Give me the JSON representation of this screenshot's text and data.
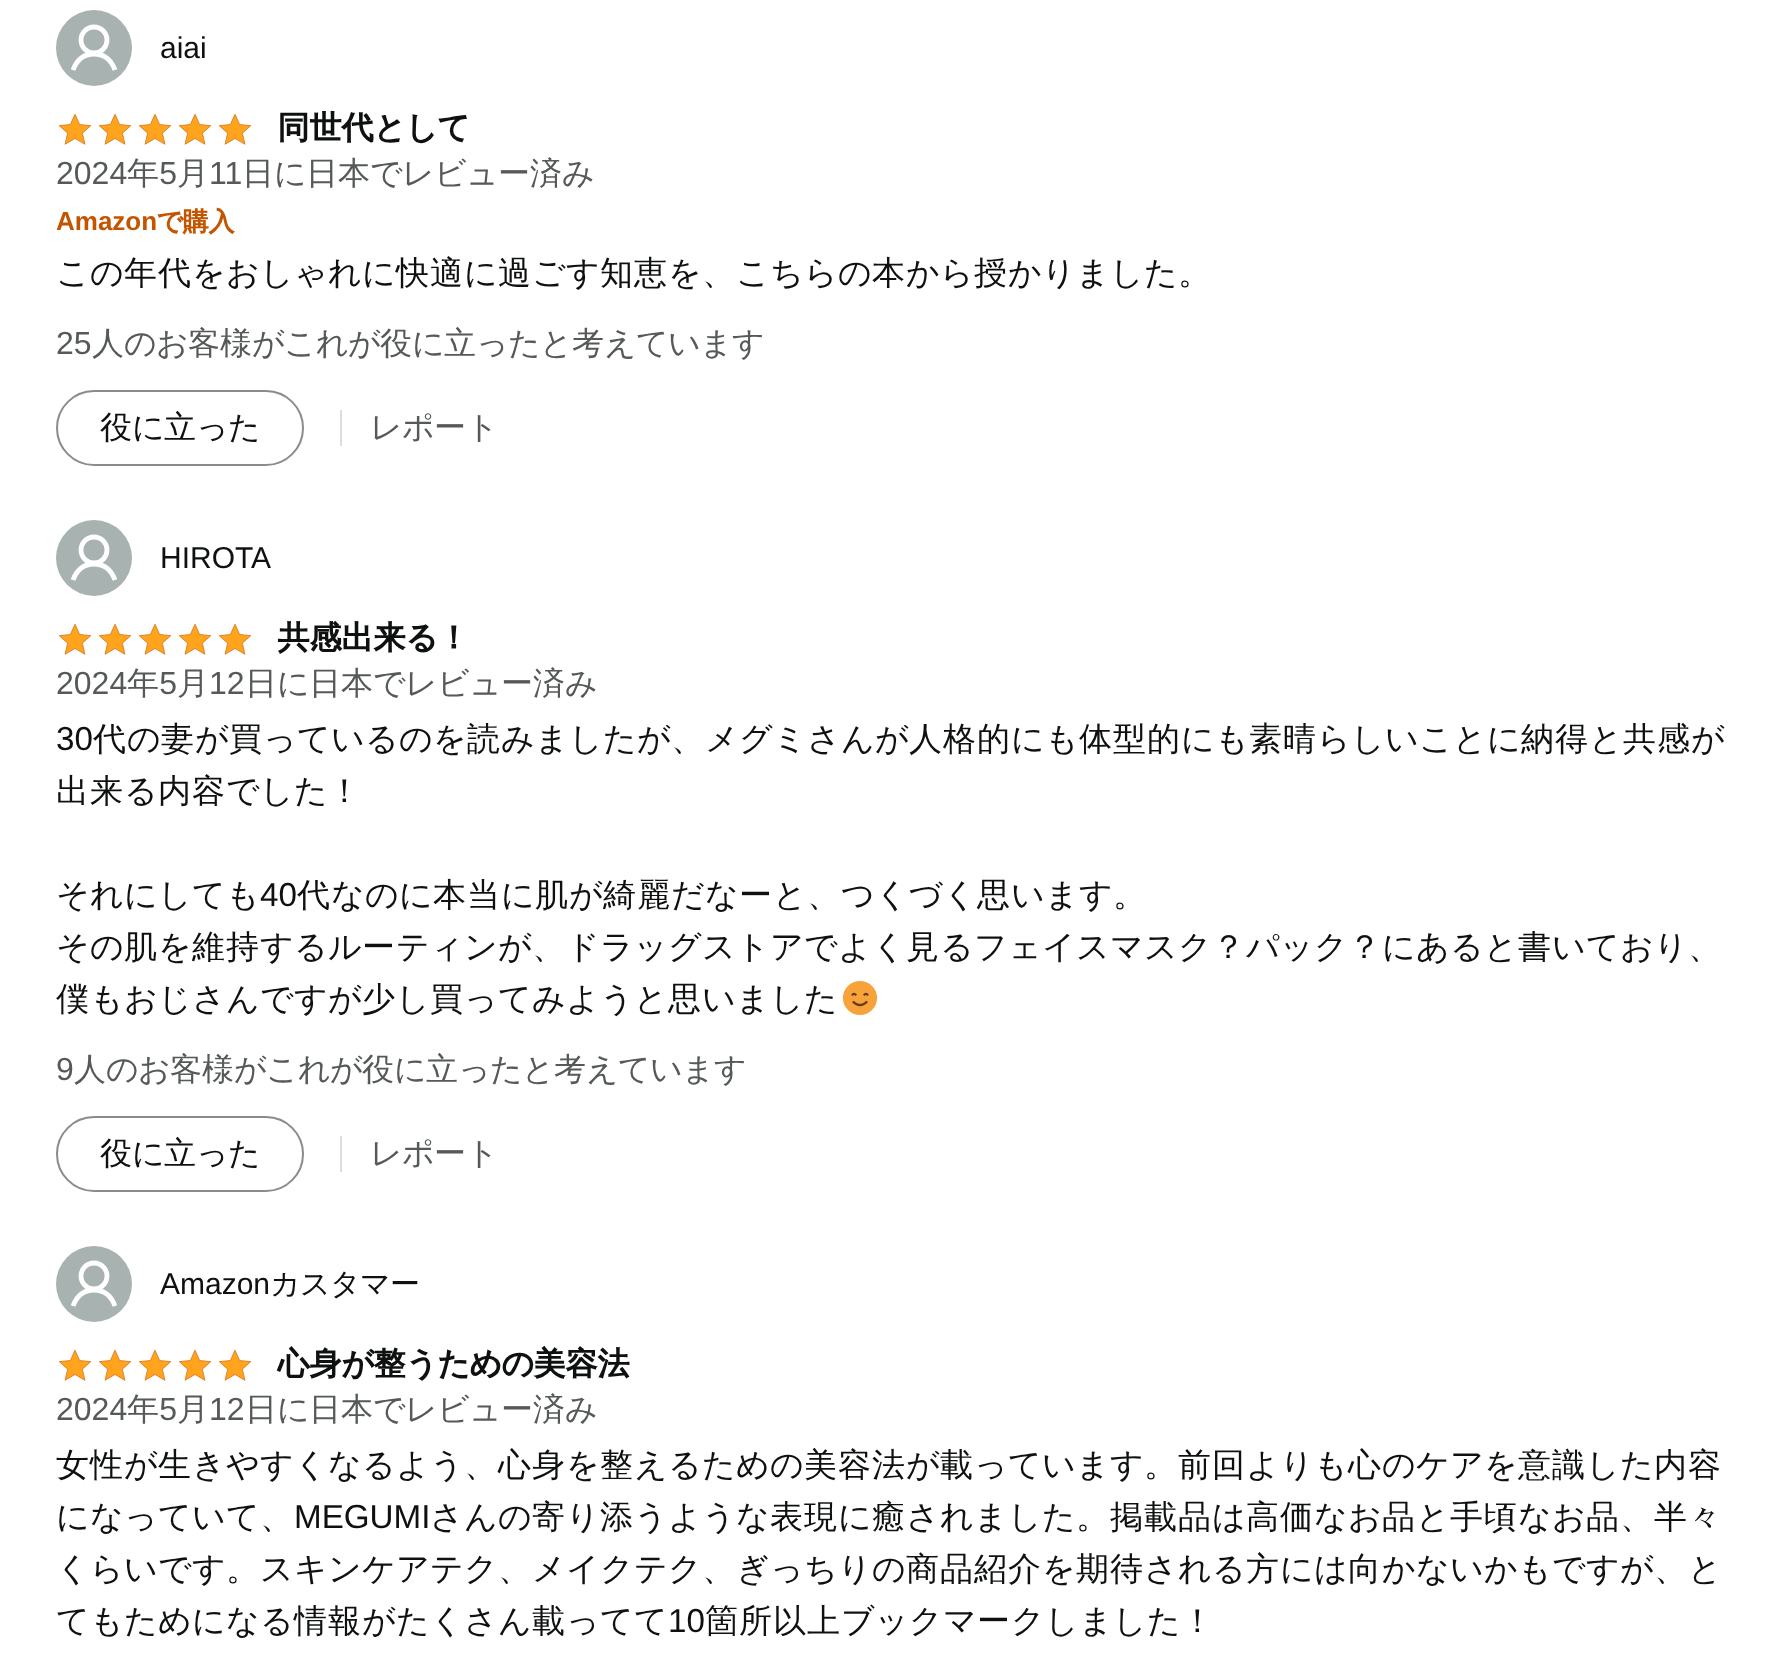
{
  "reviews": [
    {
      "author": "aiai",
      "stars": 5,
      "title": "同世代として",
      "date": "2024年5月11日に日本でレビュー済み",
      "badge": "Amazonで購入",
      "body": [
        [
          "この年代をおしゃれに快適に過ごす知恵を、こちらの本から授かりました。"
        ]
      ],
      "smiley": false,
      "helpful_count": "25人のお客様がこれが役に立ったと考えています",
      "helpful_button": "役に立った",
      "report_link": "レポート"
    },
    {
      "author": "HIROTA",
      "stars": 5,
      "title": "共感出来る！",
      "date": "2024年5月12日に日本でレビュー済み",
      "body": [
        [
          "30代の妻が買っているのを読みましたが、メグミさんが人格的にも体型的にも素晴らしいことに納得と共感が出来る内容でした！"
        ],
        [
          "それにしても40代なのに本当に肌が綺麗だなーと、つくづく思います。",
          "その肌を維持するルーティンが、ドラッグストアでよく見るフェイスマスク？パック？にあると書いており、僕もおじさんですが少し買ってみようと思いました"
        ]
      ],
      "smiley": true,
      "helpful_count": "9人のお客様がこれが役に立ったと考えています",
      "helpful_button": "役に立った",
      "report_link": "レポート"
    },
    {
      "author": "Amazonカスタマー",
      "stars": 5,
      "title": "心身が整うための美容法",
      "date": "2024年5月12日に日本でレビュー済み",
      "body": [
        [
          "女性が生きやすくなるよう、心身を整えるための美容法が載っています。前回よりも心のケアを意識した内容になっていて、MEGUMIさんの寄り添うような表現に癒されました。掲載品は高価なお品と手頃なお品、半々くらいです。スキンケアテク、メイクテク、ぎっちりの商品紹介を期待される方には向かないかもですが、とてもためになる情報がたくさん載ってて10箇所以上ブックマークしました！"
        ]
      ],
      "smiley": false
    }
  ]
}
